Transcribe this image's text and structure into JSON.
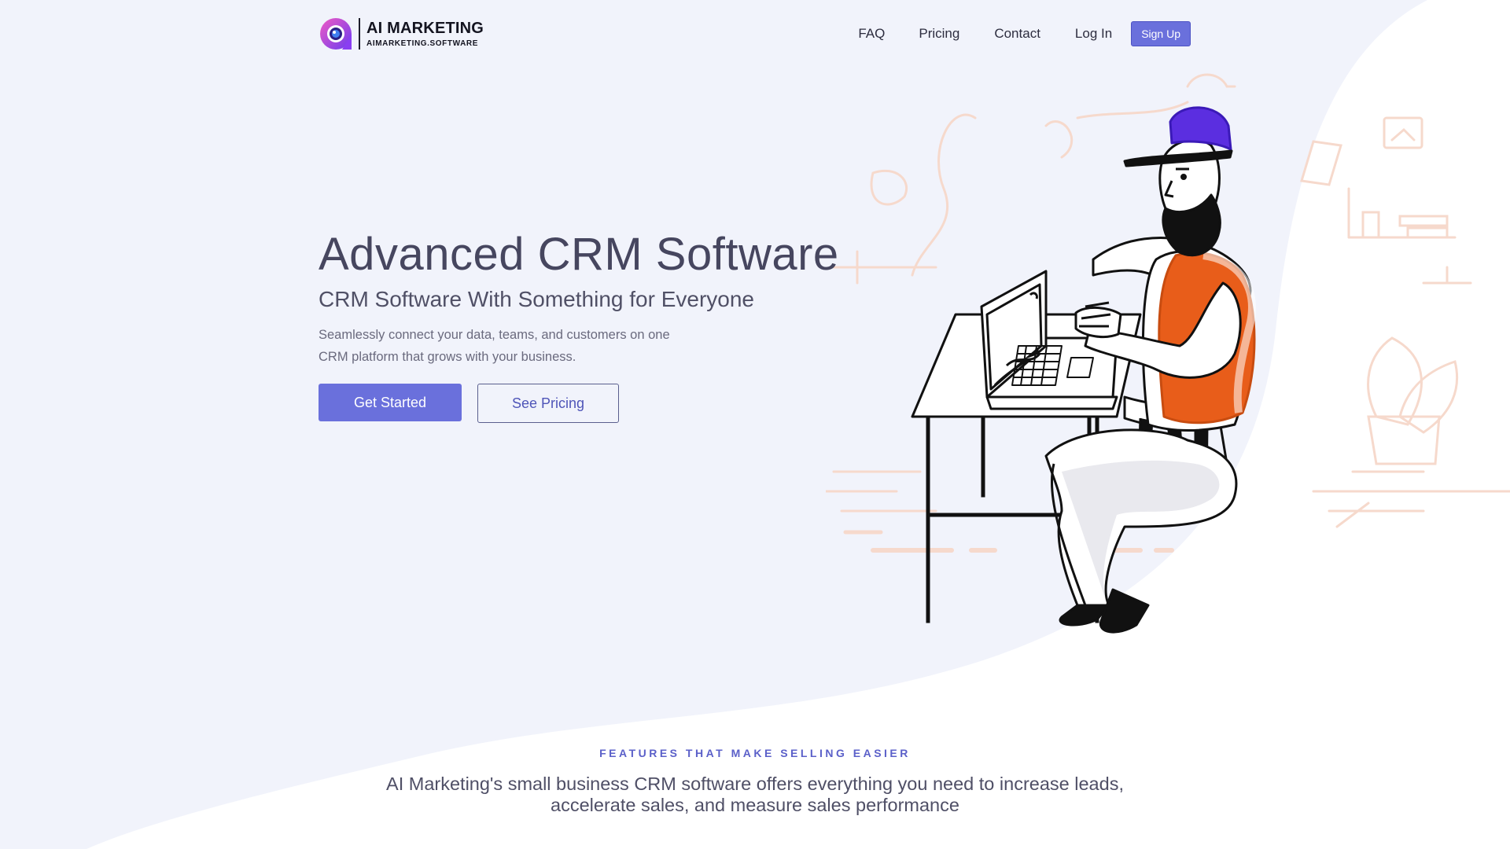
{
  "brand": {
    "title": "AI MARKETING",
    "subtitle": "AIMARKETING.SOFTWARE",
    "logo_icon": "camera-lens-logo",
    "gradient": [
      "#ec4cc6",
      "#6b3cf0"
    ]
  },
  "nav": {
    "items": [
      {
        "label": "FAQ"
      },
      {
        "label": "Pricing"
      },
      {
        "label": "Contact"
      },
      {
        "label": "Log In"
      }
    ],
    "signup_label": "Sign Up"
  },
  "hero": {
    "title": "Advanced CRM Software",
    "subtitle": "CRM Software With Something for Everyone",
    "description": "Seamlessly connect your data, teams, and customers on one CRM platform that grows with your business.",
    "primary_cta": "Get Started",
    "secondary_cta": "See Pricing"
  },
  "features": {
    "eyebrow": "FEATURES THAT MAKE SELLING EASIER",
    "lead": "AI Marketing's small business CRM software offers everything you need to increase leads, accelerate sales, and measure sales performance"
  },
  "colors": {
    "accent": "#6a70dc",
    "page_background": "#f1f3fb",
    "wave": "#ffffff",
    "vest": "#e85d1a",
    "cap": "#5b2ee0"
  }
}
